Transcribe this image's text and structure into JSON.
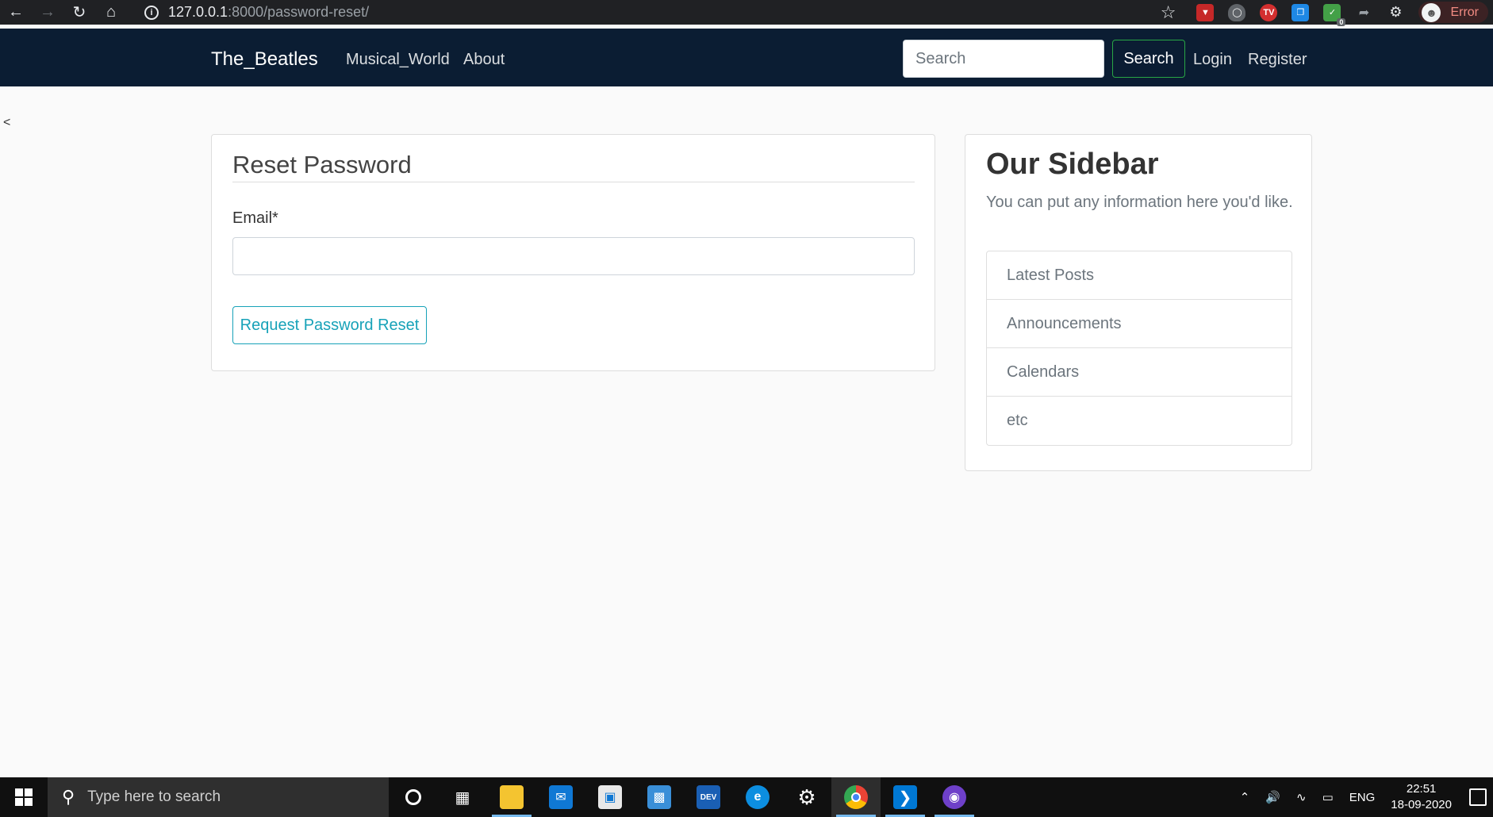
{
  "browser": {
    "url_host": "127.0.0.1",
    "url_path": ":8000/password-reset/",
    "profile_status": "Error",
    "extension_badge": "0"
  },
  "navbar": {
    "brand": "The_Beatles",
    "links": [
      "Musical_World",
      "About"
    ],
    "search_placeholder": "Search",
    "search_button": "Search",
    "login": "Login",
    "register": "Register"
  },
  "page": {
    "back_char": "<"
  },
  "reset_form": {
    "legend": "Reset Password",
    "email_label": "Email*",
    "email_value": "",
    "submit_label": "Request Password Reset"
  },
  "sidebar": {
    "title": "Our Sidebar",
    "description": "You can put any information here you'd like.",
    "items": [
      "Latest Posts",
      "Announcements",
      "Calendars",
      "etc"
    ]
  },
  "taskbar": {
    "search_placeholder": "Type here to search",
    "language": "ENG",
    "time": "22:51",
    "date": "18-09-2020"
  },
  "colors": {
    "navbar_bg": "#0b1d33",
    "search_button_border": "#28a745",
    "reset_button": "#17a2b8"
  }
}
